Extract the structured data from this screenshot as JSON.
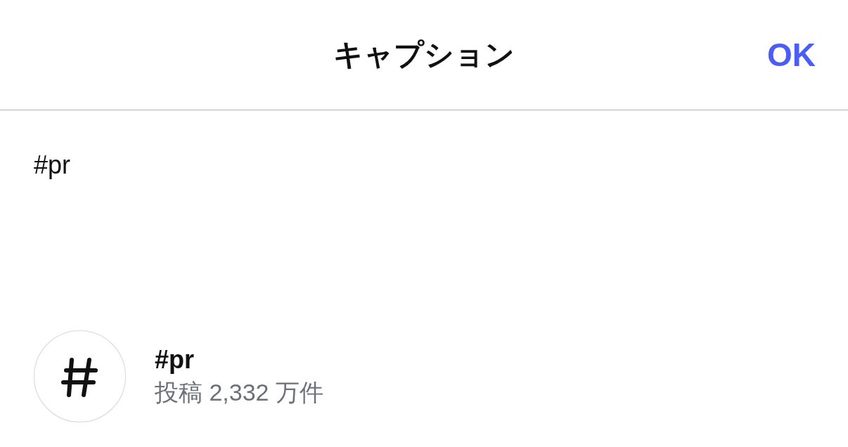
{
  "header": {
    "title": "キャプション",
    "done_button": "OK"
  },
  "caption": {
    "value": "#pr"
  },
  "suggestions": [
    {
      "tag": "#pr",
      "post_count": "投稿 2,332 万件"
    }
  ]
}
